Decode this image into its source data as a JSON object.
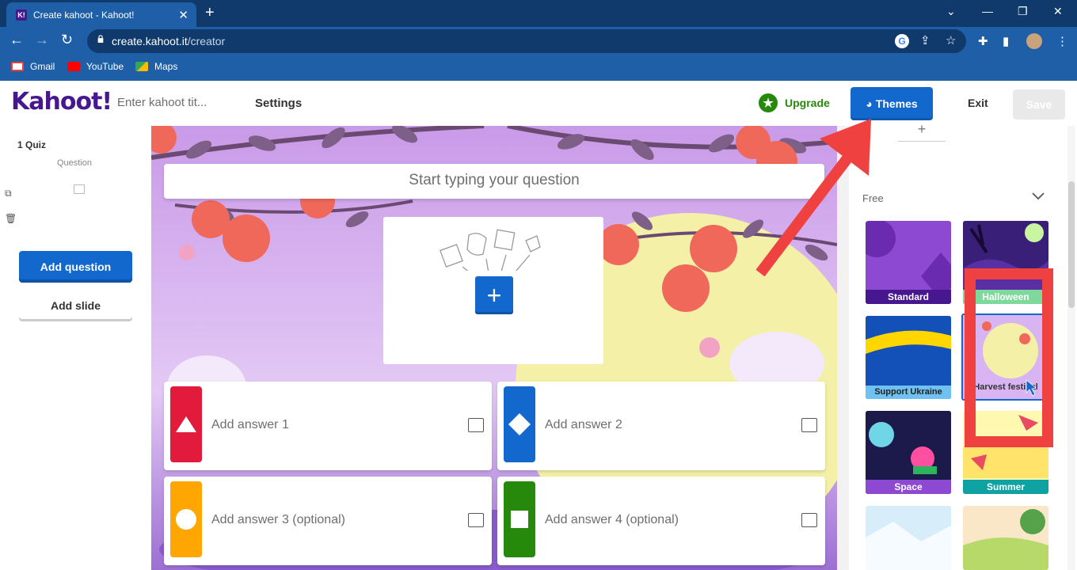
{
  "browser": {
    "tab_title": "Create kahoot - Kahoot!",
    "url_host": "create.kahoot.it",
    "url_path": "/creator",
    "bookmarks": [
      "Gmail",
      "YouTube",
      "Maps"
    ]
  },
  "header": {
    "logo": "Kahoot!",
    "title_placeholder": "Enter kahoot tit...",
    "settings": "Settings",
    "upgrade": "Upgrade",
    "themes": "Themes",
    "exit": "Exit",
    "save": "Save"
  },
  "sidebar": {
    "slide_label": "1  Quiz",
    "slide_sub": "Question",
    "add_question": "Add question",
    "add_slide": "Add slide"
  },
  "editor": {
    "question_placeholder": "Start typing your question",
    "answers": [
      "Add answer 1",
      "Add answer 2",
      "Add answer 3 (optional)",
      "Add answer 4 (optional)"
    ]
  },
  "themes_panel": {
    "section_label": "Free",
    "themes": [
      "Standard",
      "Halloween",
      "Support Ukraine",
      "Harvest festival",
      "Space",
      "Summer"
    ]
  },
  "colors": {
    "kahoot_purple": "#46178f",
    "blue": "#1368ce",
    "red": "#e21b3c",
    "blue_answer": "#1368ce",
    "yellow": "#ffa602",
    "green": "#26890c"
  }
}
